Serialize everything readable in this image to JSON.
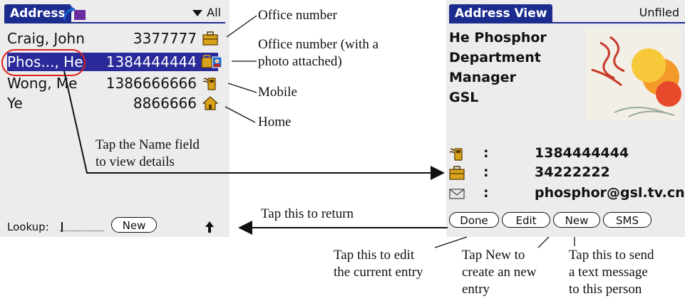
{
  "left_screen": {
    "tab_title": "Address",
    "category": "All",
    "rows": [
      {
        "name": "Craig, John",
        "number": "3377777",
        "icon": "office-icon",
        "selected": false
      },
      {
        "name": "Phos..., He",
        "number": "1384444444",
        "icon": "office-photo-icon",
        "selected": true
      },
      {
        "name": "Wong, Me",
        "number": "1386666666",
        "icon": "mobile-icon",
        "selected": false
      },
      {
        "name": "Ye",
        "number": "8866666",
        "icon": "home-icon",
        "selected": false
      }
    ],
    "lookup_label": "Lookup:",
    "new_button": "New"
  },
  "right_screen": {
    "tab_title": "Address View",
    "category": "Unfiled",
    "name": "He Phosphor",
    "department": "Department",
    "title": "Manager",
    "company": "GSL",
    "fields": [
      {
        "icon": "mobile-icon",
        "colon": ":",
        "value": "1384444444"
      },
      {
        "icon": "office-icon",
        "colon": ":",
        "value": "34222222"
      },
      {
        "icon": "email-icon",
        "colon": ":",
        "value": "phosphor@gsl.tv.cn"
      }
    ],
    "buttons": {
      "done": "Done",
      "edit": "Edit",
      "new": "New",
      "sms": "SMS"
    }
  },
  "annotations": {
    "office_number": "Office number",
    "office_photo_1": "Office number (with a",
    "office_photo_2": "photo attached)",
    "mobile": "Mobile",
    "home": "Home",
    "tap_name_1": "Tap the Name field",
    "tap_name_2": "to view details",
    "tap_return": "Tap this to return",
    "tap_edit_1": "Tap this to edit",
    "tap_edit_2": "the current entry",
    "tap_new_1": "Tap New to",
    "tap_new_2": "create an new",
    "tap_new_3": "entry",
    "tap_sms_1": "Tap this to send",
    "tap_sms_2": "a text message",
    "tap_sms_3": "to this person"
  },
  "colors": {
    "palm_blue": "#1c2c8e",
    "highlight": "#2a2a9a",
    "oval_red": "#e02020",
    "screen_bg": "#ececec"
  }
}
